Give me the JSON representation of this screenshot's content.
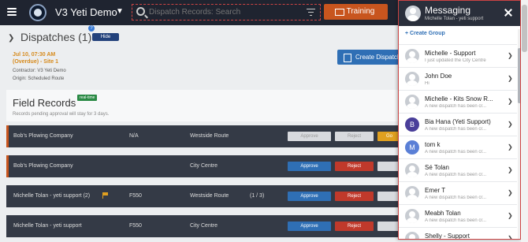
{
  "header": {
    "org_name": "V3 Yeti Demo",
    "search_placeholder": "Dispatch Records: Search",
    "training_label": "Training"
  },
  "dispatches": {
    "title": "Dispatches (1)",
    "hide_label": "Hide",
    "help": "?",
    "item": {
      "date": "Jul 10, 07:30 AM",
      "overdue": "(Overdue) - Site 1",
      "contractor": "Contractor: V3 Yeti Demo",
      "origin": "Origin: Scheduled Route"
    },
    "create_label": "Create Dispatch"
  },
  "field_records": {
    "title": "Field Records",
    "badge": "real-time",
    "subtitle": "Records pending approval will stay for 3 days.",
    "rows": [
      {
        "name": "Bob's Plowing Company",
        "vehicle": "N/A",
        "route": "Westside Route",
        "count": "",
        "approve": "Approve",
        "reject": "Reject",
        "more": "Go",
        "disabled": true,
        "flag": false
      },
      {
        "name": "Bob's Plowing Company",
        "vehicle": "",
        "route": "City Centre",
        "count": "",
        "approve": "Approve",
        "reject": "Reject",
        "more": "",
        "disabled": false,
        "flag": false
      },
      {
        "name": "Michelle Tolan - yeti support (2)",
        "vehicle": "F550",
        "route": "Westside Route",
        "count": "(1 / 3)",
        "approve": "Approve",
        "reject": "Reject",
        "more": "",
        "disabled": false,
        "flag": true
      },
      {
        "name": "Michelle Tolan - yeti support",
        "vehicle": "F550",
        "route": "City Centre",
        "count": "",
        "approve": "Approve",
        "reject": "Reject",
        "more": "",
        "disabled": false,
        "flag": false
      }
    ]
  },
  "messaging": {
    "title": "Messaging",
    "user": "Michelle Tolan - yeti support",
    "create_group": "+ Create Group",
    "conversations": [
      {
        "name": "Michelle - Support",
        "preview": "I just updated the City Centre",
        "avatar": "",
        "avatar_color": ""
      },
      {
        "name": "John Doe",
        "preview": "Hi",
        "avatar": "",
        "avatar_color": ""
      },
      {
        "name": "Michelle - Kits Snow R...",
        "preview": "A new dispatch has been cr...",
        "avatar": "",
        "avatar_color": ""
      },
      {
        "name": "Bia Hana (Yeti Support)",
        "preview": "A new dispatch has been cr...",
        "avatar": "B",
        "avatar_color": "#4a3f9a"
      },
      {
        "name": "tom k",
        "preview": "A new dispatch has been cr...",
        "avatar": "M",
        "avatar_color": "#5a7fd6"
      },
      {
        "name": "Sé Tolan",
        "preview": "A new dispatch has been cr...",
        "avatar": "",
        "avatar_color": ""
      },
      {
        "name": "Emer T",
        "preview": "A new dispatch has been cr...",
        "avatar": "",
        "avatar_color": ""
      },
      {
        "name": "Meabh Tolan",
        "preview": "A new dispatch has been cr...",
        "avatar": "",
        "avatar_color": ""
      },
      {
        "name": "Shelly - Support",
        "preview": "",
        "avatar": "",
        "avatar_color": ""
      }
    ]
  }
}
